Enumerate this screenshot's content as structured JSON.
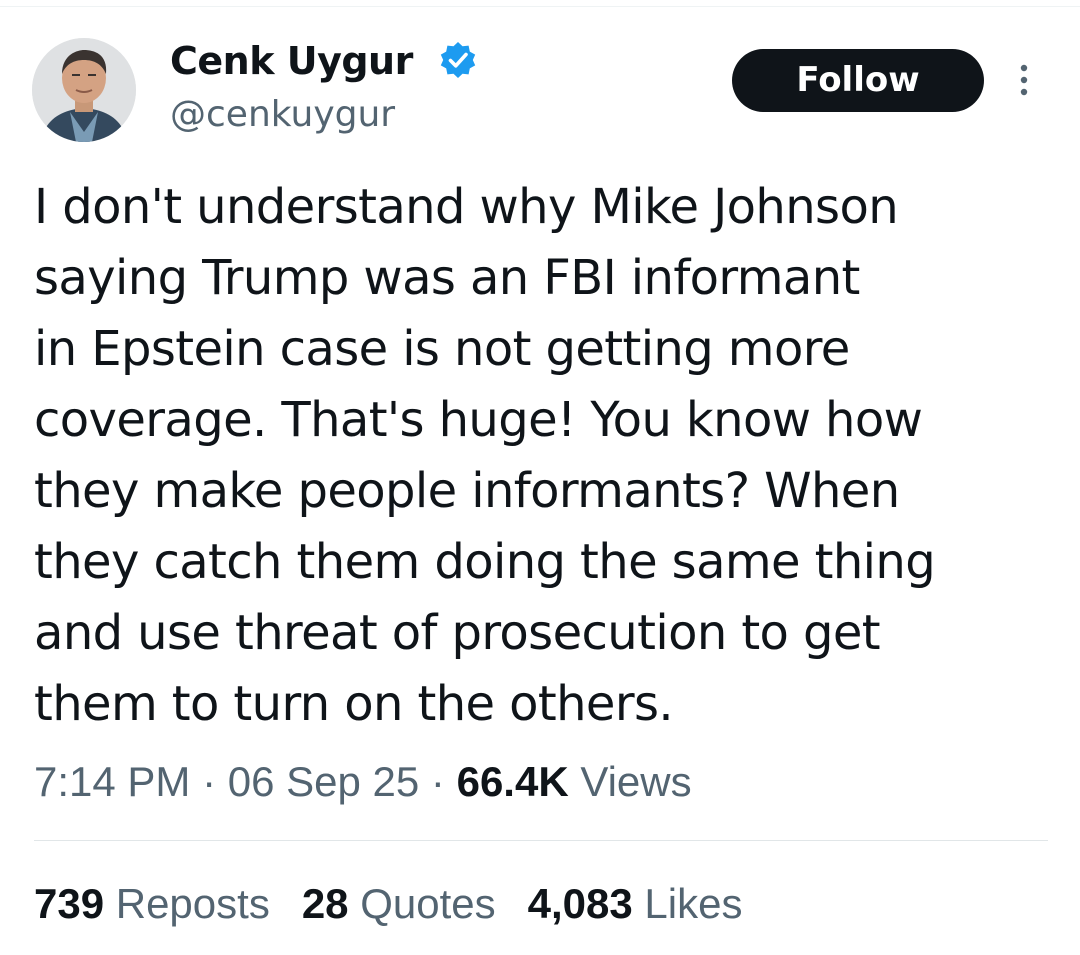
{
  "author": {
    "display_name": "Cenk Uygur",
    "handle": "@cenkuygur",
    "verified": true,
    "avatar": "profile-photo"
  },
  "actions": {
    "follow_label": "Follow",
    "more_icon": "more-vertical-icon"
  },
  "tweet": {
    "lines": [
      "I don't understand why Mike Johnson",
      "saying Trump was an FBI informant",
      "in Epstein case is not getting more",
      "coverage. That's huge! You know how",
      "they make people informants? When",
      "they catch them doing the same thing",
      "and use threat of prosecution to get",
      "them to turn on the others."
    ]
  },
  "meta": {
    "time": "7:14 PM",
    "separator": " · ",
    "date": "06 Sep 25",
    "views_count": "66.4K",
    "views_label": " Views"
  },
  "stats": [
    {
      "count": "739",
      "label": " Reposts"
    },
    {
      "count": "28",
      "label": " Quotes"
    },
    {
      "count": "4,083",
      "label": " Likes"
    }
  ],
  "colors": {
    "text": "#0f1419",
    "secondary": "#536471",
    "verified_blue": "#1d9bf0",
    "button_bg": "#0f1419"
  }
}
